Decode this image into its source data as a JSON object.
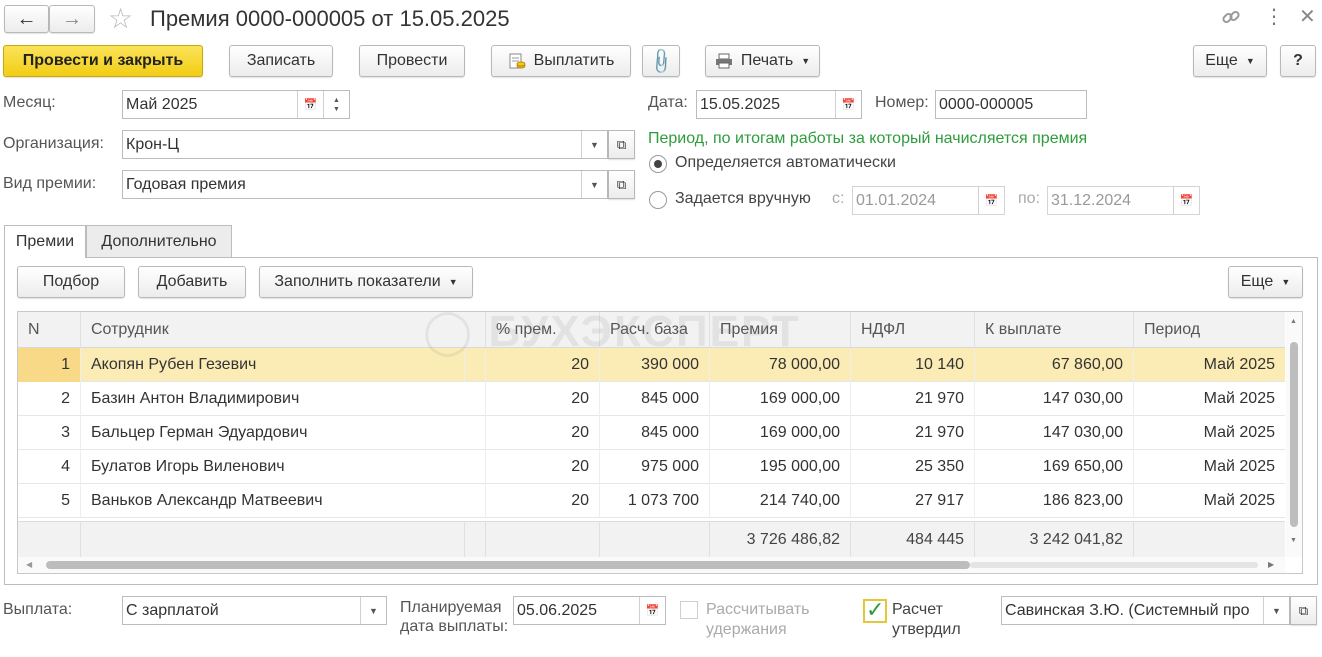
{
  "window": {
    "title": "Премия 0000-000005 от 15.05.2025"
  },
  "toolbar": {
    "post_close": "Провести и закрыть",
    "save": "Записать",
    "post": "Провести",
    "pay": "Выплатить",
    "print": "Печать",
    "more": "Еще",
    "help": "?"
  },
  "header": {
    "month_label": "Месяц:",
    "month_value": "Май 2025",
    "org_label": "Организация:",
    "org_value": "Крон-Ц",
    "bonus_type_label": "Вид премии:",
    "bonus_type_value": "Годовая премия",
    "date_label": "Дата:",
    "date_value": "15.05.2025",
    "number_label": "Номер:",
    "number_value": "0000-000005",
    "period_title": "Период, по итогам работы за который начисляется премия",
    "radio_auto": "Определяется автоматически",
    "radio_manual": "Задается вручную",
    "from_label": "с:",
    "from_value": "01.01.2024",
    "to_label": "по:",
    "to_value": "31.12.2024"
  },
  "tabs": [
    {
      "label": "Премии",
      "active": true
    },
    {
      "label": "Дополнительно",
      "active": false
    }
  ],
  "table_toolbar": {
    "pick": "Подбор",
    "add": "Добавить",
    "fill": "Заполнить показатели",
    "more": "Еще"
  },
  "table": {
    "columns": [
      "N",
      "Сотрудник",
      "% прем.",
      "Расч. база",
      "Премия",
      "НДФЛ",
      "К выплате",
      "Период"
    ],
    "rows": [
      {
        "n": "1",
        "employee": "Акопян Рубен Гезевич",
        "pct": "20",
        "base": "390 000",
        "bonus": "78 000,00",
        "tax": "10 140",
        "payout": "67 860,00",
        "period": "Май 2025"
      },
      {
        "n": "2",
        "employee": "Базин Антон Владимирович",
        "pct": "20",
        "base": "845 000",
        "bonus": "169 000,00",
        "tax": "21 970",
        "payout": "147 030,00",
        "period": "Май 2025"
      },
      {
        "n": "3",
        "employee": "Бальцер Герман Эдуардович",
        "pct": "20",
        "base": "845 000",
        "bonus": "169 000,00",
        "tax": "21 970",
        "payout": "147 030,00",
        "period": "Май 2025"
      },
      {
        "n": "4",
        "employee": "Булатов Игорь Виленович",
        "pct": "20",
        "base": "975 000",
        "bonus": "195 000,00",
        "tax": "25 350",
        "payout": "169 650,00",
        "period": "Май 2025"
      },
      {
        "n": "5",
        "employee": "Ваньков Александр Матвеевич",
        "pct": "20",
        "base": "1 073 700",
        "bonus": "214 740,00",
        "tax": "27 917",
        "payout": "186 823,00",
        "period": "Май 2025"
      }
    ],
    "totals": {
      "bonus": "3 726 486,82",
      "tax": "484 445",
      "payout": "3 242 041,82"
    }
  },
  "watermark": "БУХЭКСПЕРТ",
  "footer": {
    "payout_label": "Выплата:",
    "payout_value": "С зарплатой",
    "planned_date_label": "Планируемая дата выплаты:",
    "planned_date_value": "05.06.2025",
    "calc_withholdings": "Рассчитывать удержания",
    "approved_label": "Расчет утвердил",
    "approver_value": "Савинская З.Ю. (Системный про"
  },
  "colors": {
    "primary_button": "#f2cd14",
    "selected_row": "#fbecb5",
    "period_title": "#2e9c3c"
  }
}
